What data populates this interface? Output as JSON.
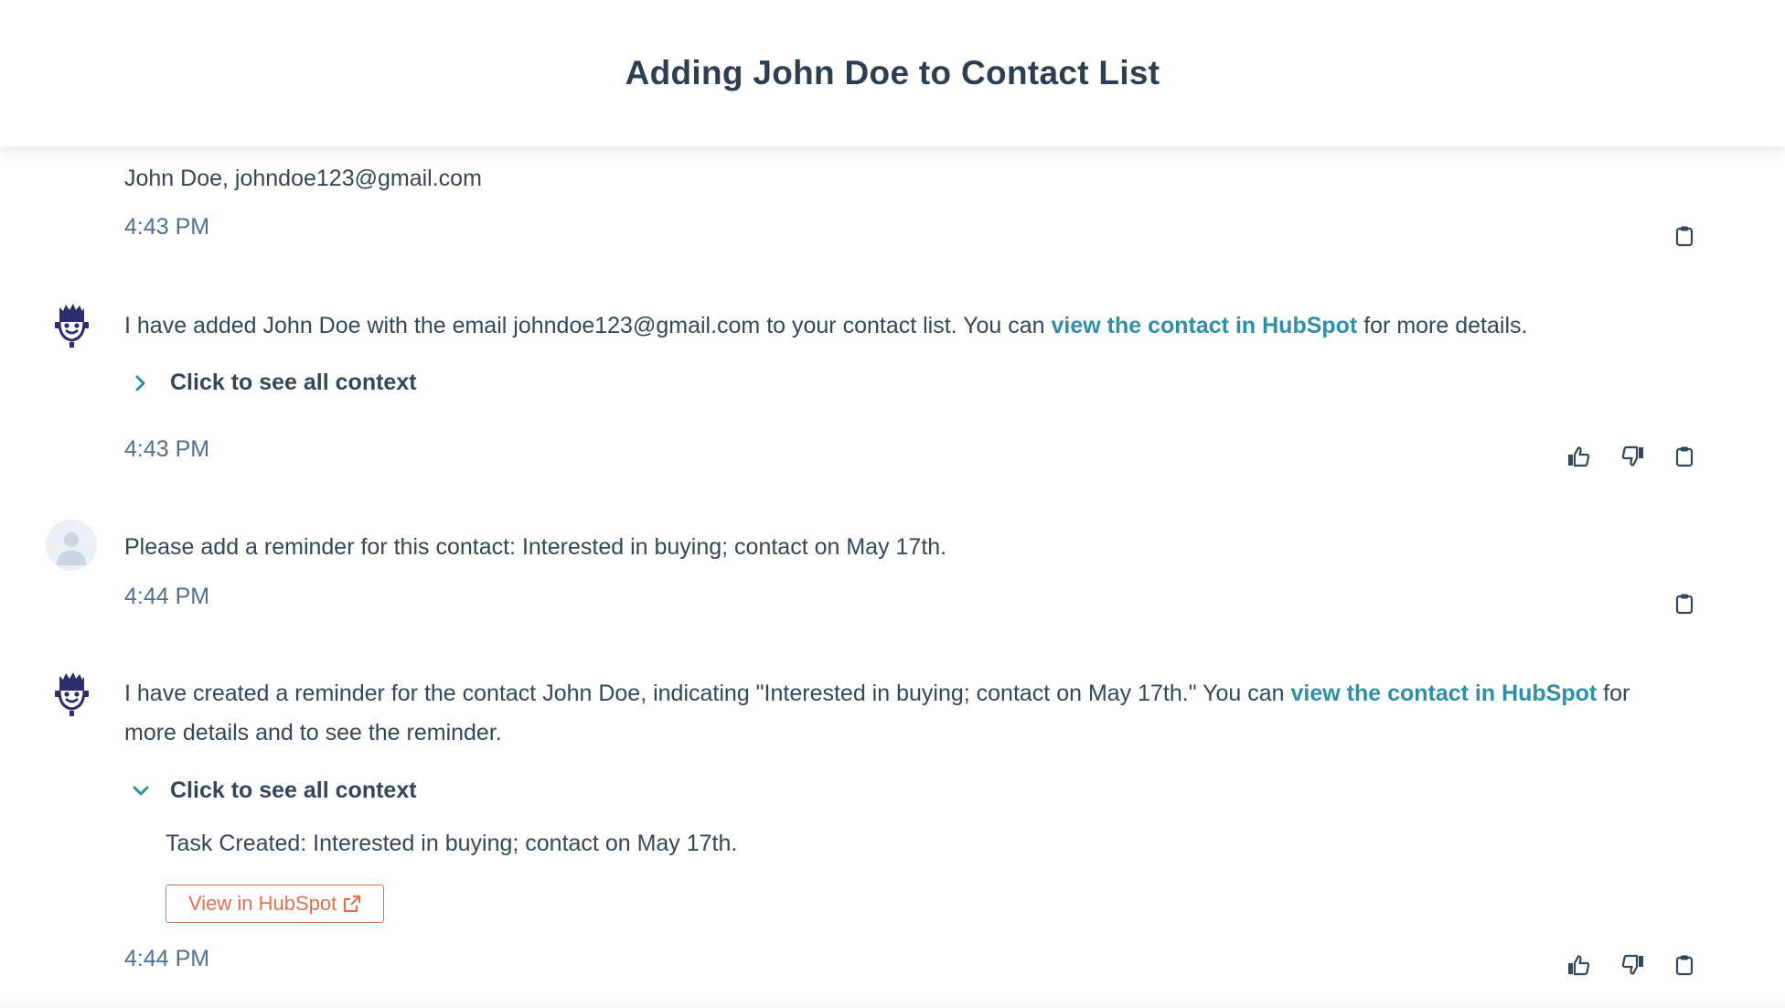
{
  "header": {
    "title": "Adding John Doe to Contact List"
  },
  "messages": {
    "m1": {
      "text": "John Doe, johndoe123@gmail.com",
      "time": "4:43 PM"
    },
    "m2": {
      "text_before": "I have added John Doe with the email johndoe123@gmail.com to your contact list. You can ",
      "link": "view the contact in HubSpot",
      "text_after": " for more details.",
      "context_label": "Click to see all context",
      "time": "4:43 PM"
    },
    "m3": {
      "text": "Please add a reminder for this contact: Interested in buying; contact on May 17th.",
      "time": "4:44 PM"
    },
    "m4": {
      "text_before": "I have created a reminder for the contact John Doe, indicating \"Interested in buying; contact on May 17th.\" You can ",
      "link": "view the contact in HubSpot",
      "text_after": " for more details and to see the reminder.",
      "context_label": "Click to see all context",
      "context_body": "Task Created: Interested in buying; contact on May 17th.",
      "button_label": "View in HubSpot",
      "time": "4:44 PM"
    }
  },
  "icons": {
    "copy": "clipboard-icon",
    "like": "thumbs-up-icon",
    "dislike": "thumbs-down-icon",
    "bot": "bot-avatar-icon",
    "user": "user-avatar-icon",
    "external": "external-link-icon",
    "chevron_right": "chevron-right-icon",
    "chevron_down": "chevron-down-icon"
  },
  "colors": {
    "text": "#33475b",
    "link": "#2f8fa8",
    "accent": "#e0734f",
    "bot": "#2b2d6e"
  }
}
